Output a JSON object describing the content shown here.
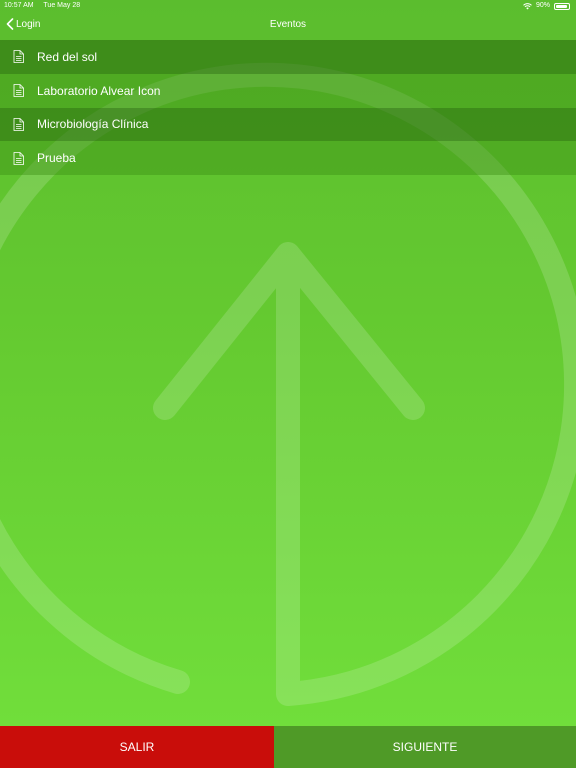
{
  "status_bar": {
    "time": "10:57 AM",
    "date": "Tue May 28",
    "battery": "90%",
    "battery_level": 0.9,
    "wifi_icon": "wifi-icon",
    "battery_icon": "battery-icon"
  },
  "nav": {
    "back_label": "Login",
    "back_icon": "chevron-left-icon",
    "title": "Eventos"
  },
  "events": [
    {
      "label": "Red del sol",
      "icon": "document-icon"
    },
    {
      "label": "Laboratorio Alvear Icon",
      "icon": "document-icon"
    },
    {
      "label": "Microbiología Clínica",
      "icon": "document-icon"
    },
    {
      "label": "Prueba",
      "icon": "document-icon"
    }
  ],
  "buttons": {
    "exit_label": "SALIR",
    "next_label": "SIGUIENTE"
  },
  "colors": {
    "exit_button": "#c90d0a",
    "next_button": "#4f9a27",
    "background_top": "#5bbd2e",
    "background_bottom": "#72e03c"
  },
  "background_icon": "upload-arrow-icon"
}
